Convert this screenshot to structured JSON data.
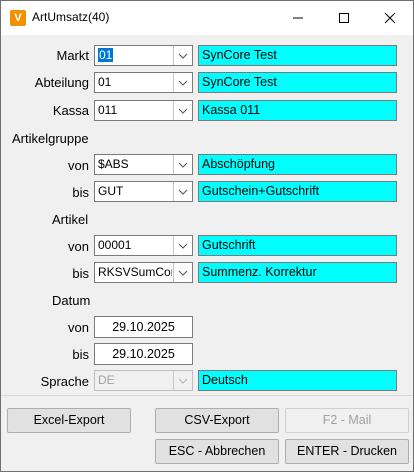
{
  "window": {
    "title": "ArtUmsatz(40)",
    "icon_letter": "V",
    "icon_color": "#f29100",
    "minimize_icon": "minimize-icon",
    "maximize_icon": "maximize-icon",
    "close_icon": "close-icon"
  },
  "form": {
    "markt": {
      "label": "Markt",
      "value": "01",
      "info": "SynCore Test"
    },
    "abteilung": {
      "label": "Abteilung",
      "value": "01",
      "info": "SynCore Test"
    },
    "kassa": {
      "label": "Kassa",
      "value": "011",
      "info": "Kassa 011"
    },
    "artikelgruppe": {
      "label": "Artikelgruppe",
      "von": {
        "label": "von",
        "value": "$ABS",
        "info": "Abschöpfung"
      },
      "bis": {
        "label": "bis",
        "value": "GUT",
        "info": "Gutschein+Gutschrift"
      }
    },
    "artikel": {
      "label": "Artikel",
      "von": {
        "label": "von",
        "value": "00001",
        "info": "Gutschrift"
      },
      "bis": {
        "label": "bis",
        "value": "RKSVSumCor",
        "info": "Summenz. Korrektur"
      }
    },
    "datum": {
      "label": "Datum",
      "von": {
        "label": "von",
        "value": "29.10.2025"
      },
      "bis": {
        "label": "bis",
        "value": "29.10.2025"
      }
    },
    "sprache": {
      "label": "Sprache",
      "value": "DE",
      "info": "Deutsch"
    },
    "info_color": "#00ffff"
  },
  "buttons": {
    "excel": "Excel-Export",
    "csv": "CSV-Export",
    "mail": "F2 - Mail",
    "cancel": "ESC - Abbrechen",
    "print": "ENTER - Drucken"
  }
}
